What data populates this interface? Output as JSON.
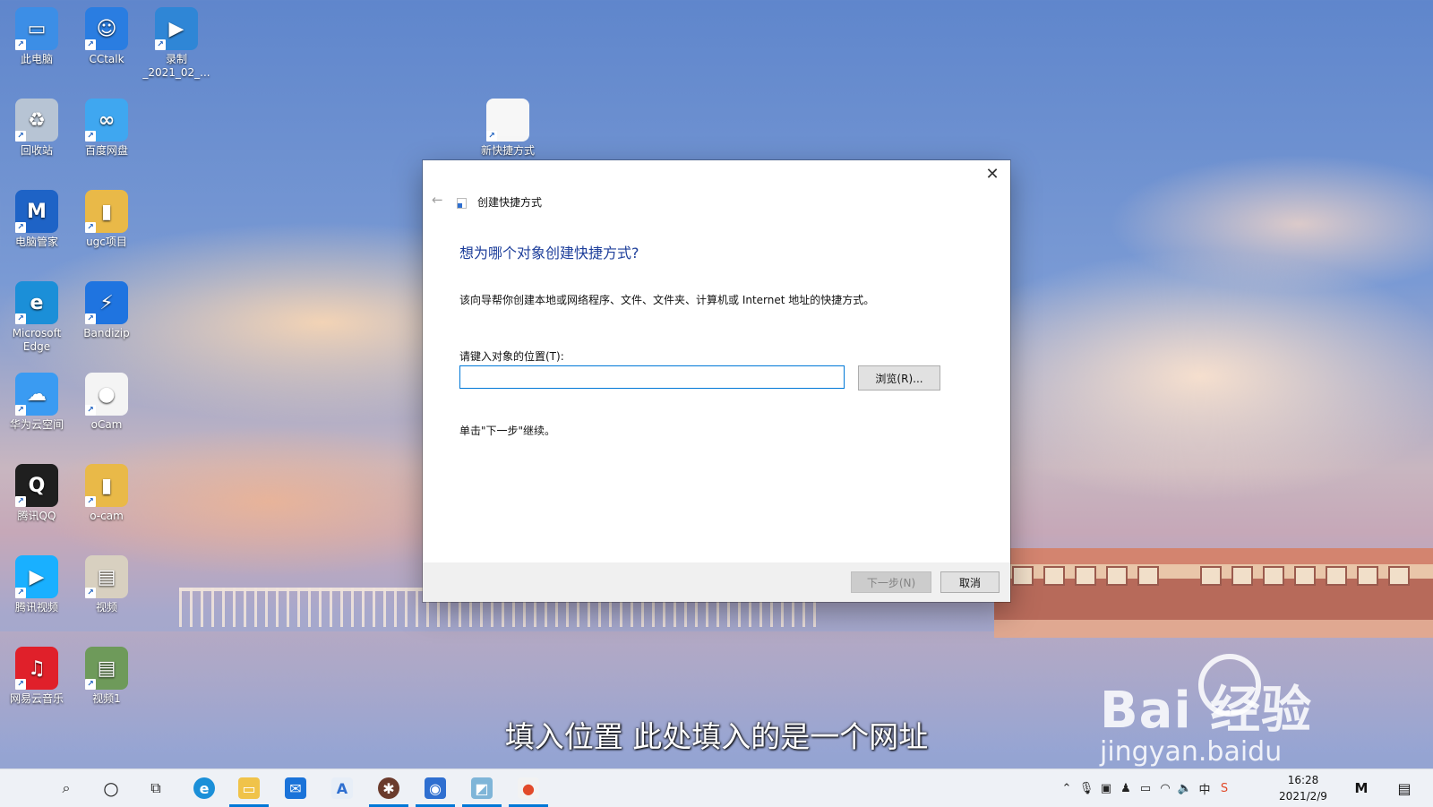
{
  "desktop": {
    "icons": [
      {
        "label": "此电脑",
        "color": "#3c8ee6",
        "glyph": "▭"
      },
      {
        "label": "CCtalk",
        "color": "#2a7de1",
        "glyph": "☺"
      },
      {
        "label": "录制",
        "label2": "_2021_02_...",
        "color": "#2f86d6",
        "glyph": "▶"
      },
      {
        "label": "回收站",
        "color": "#b7c4d4",
        "glyph": "♻"
      },
      {
        "label": "百度网盘",
        "color": "#3fa7f0",
        "glyph": "∞"
      },
      {
        "label": "新快捷方式",
        "color": "#f7f7f7",
        "glyph": ""
      },
      {
        "label": "电脑管家",
        "color": "#1e63c6",
        "glyph": "M"
      },
      {
        "label": "ugc项目",
        "color": "#e9b948",
        "glyph": "▮"
      },
      {
        "label": "Microsoft",
        "label2": "Edge",
        "color": "#1b8fd8",
        "glyph": "e"
      },
      {
        "label": "Bandizip",
        "color": "#1f74e0",
        "glyph": "⚡"
      },
      {
        "label": "华为云空间",
        "color": "#3a9bf2",
        "glyph": "☁"
      },
      {
        "label": "oCam",
        "color": "#f4f4f4",
        "glyph": "●"
      },
      {
        "label": "腾讯QQ",
        "color": "#1f1f1f",
        "glyph": "Q"
      },
      {
        "label": "o-cam",
        "color": "#e9b948",
        "glyph": "▮"
      },
      {
        "label": "腾讯视频",
        "color": "#19b0ff",
        "glyph": "▶"
      },
      {
        "label": "视频",
        "color": "#d8d0c0",
        "glyph": "▤"
      },
      {
        "label": "网易云音乐",
        "color": "#e0202a",
        "glyph": "♫"
      },
      {
        "label": "视频1",
        "color": "#6e9a5a",
        "glyph": "▤"
      }
    ]
  },
  "dialog": {
    "wizard_title": "创建快捷方式",
    "heading": "想为哪个对象创建快捷方式?",
    "description": "该向导帮你创建本地或网络程序、文件、文件夹、计算机或 Internet 地址的快捷方式。",
    "location_label": "请键入对象的位置(T):",
    "location_value": "",
    "browse_label": "浏览(R)...",
    "continue_note": "单击\"下一步\"继续。",
    "next_label": "下一步(N)",
    "cancel_label": "取消",
    "close_glyph": "✕",
    "back_glyph": "←"
  },
  "overlay": {
    "subtitle": "填入位置 此处填入的是一个网址",
    "watermark_brand": "Bai  经验",
    "watermark_url": "jingyan.baidu"
  },
  "taskbar": {
    "clock_time": "16:28",
    "clock_date": "2021/2/9",
    "ime_indicator": "中",
    "accent": "#0078d7"
  }
}
